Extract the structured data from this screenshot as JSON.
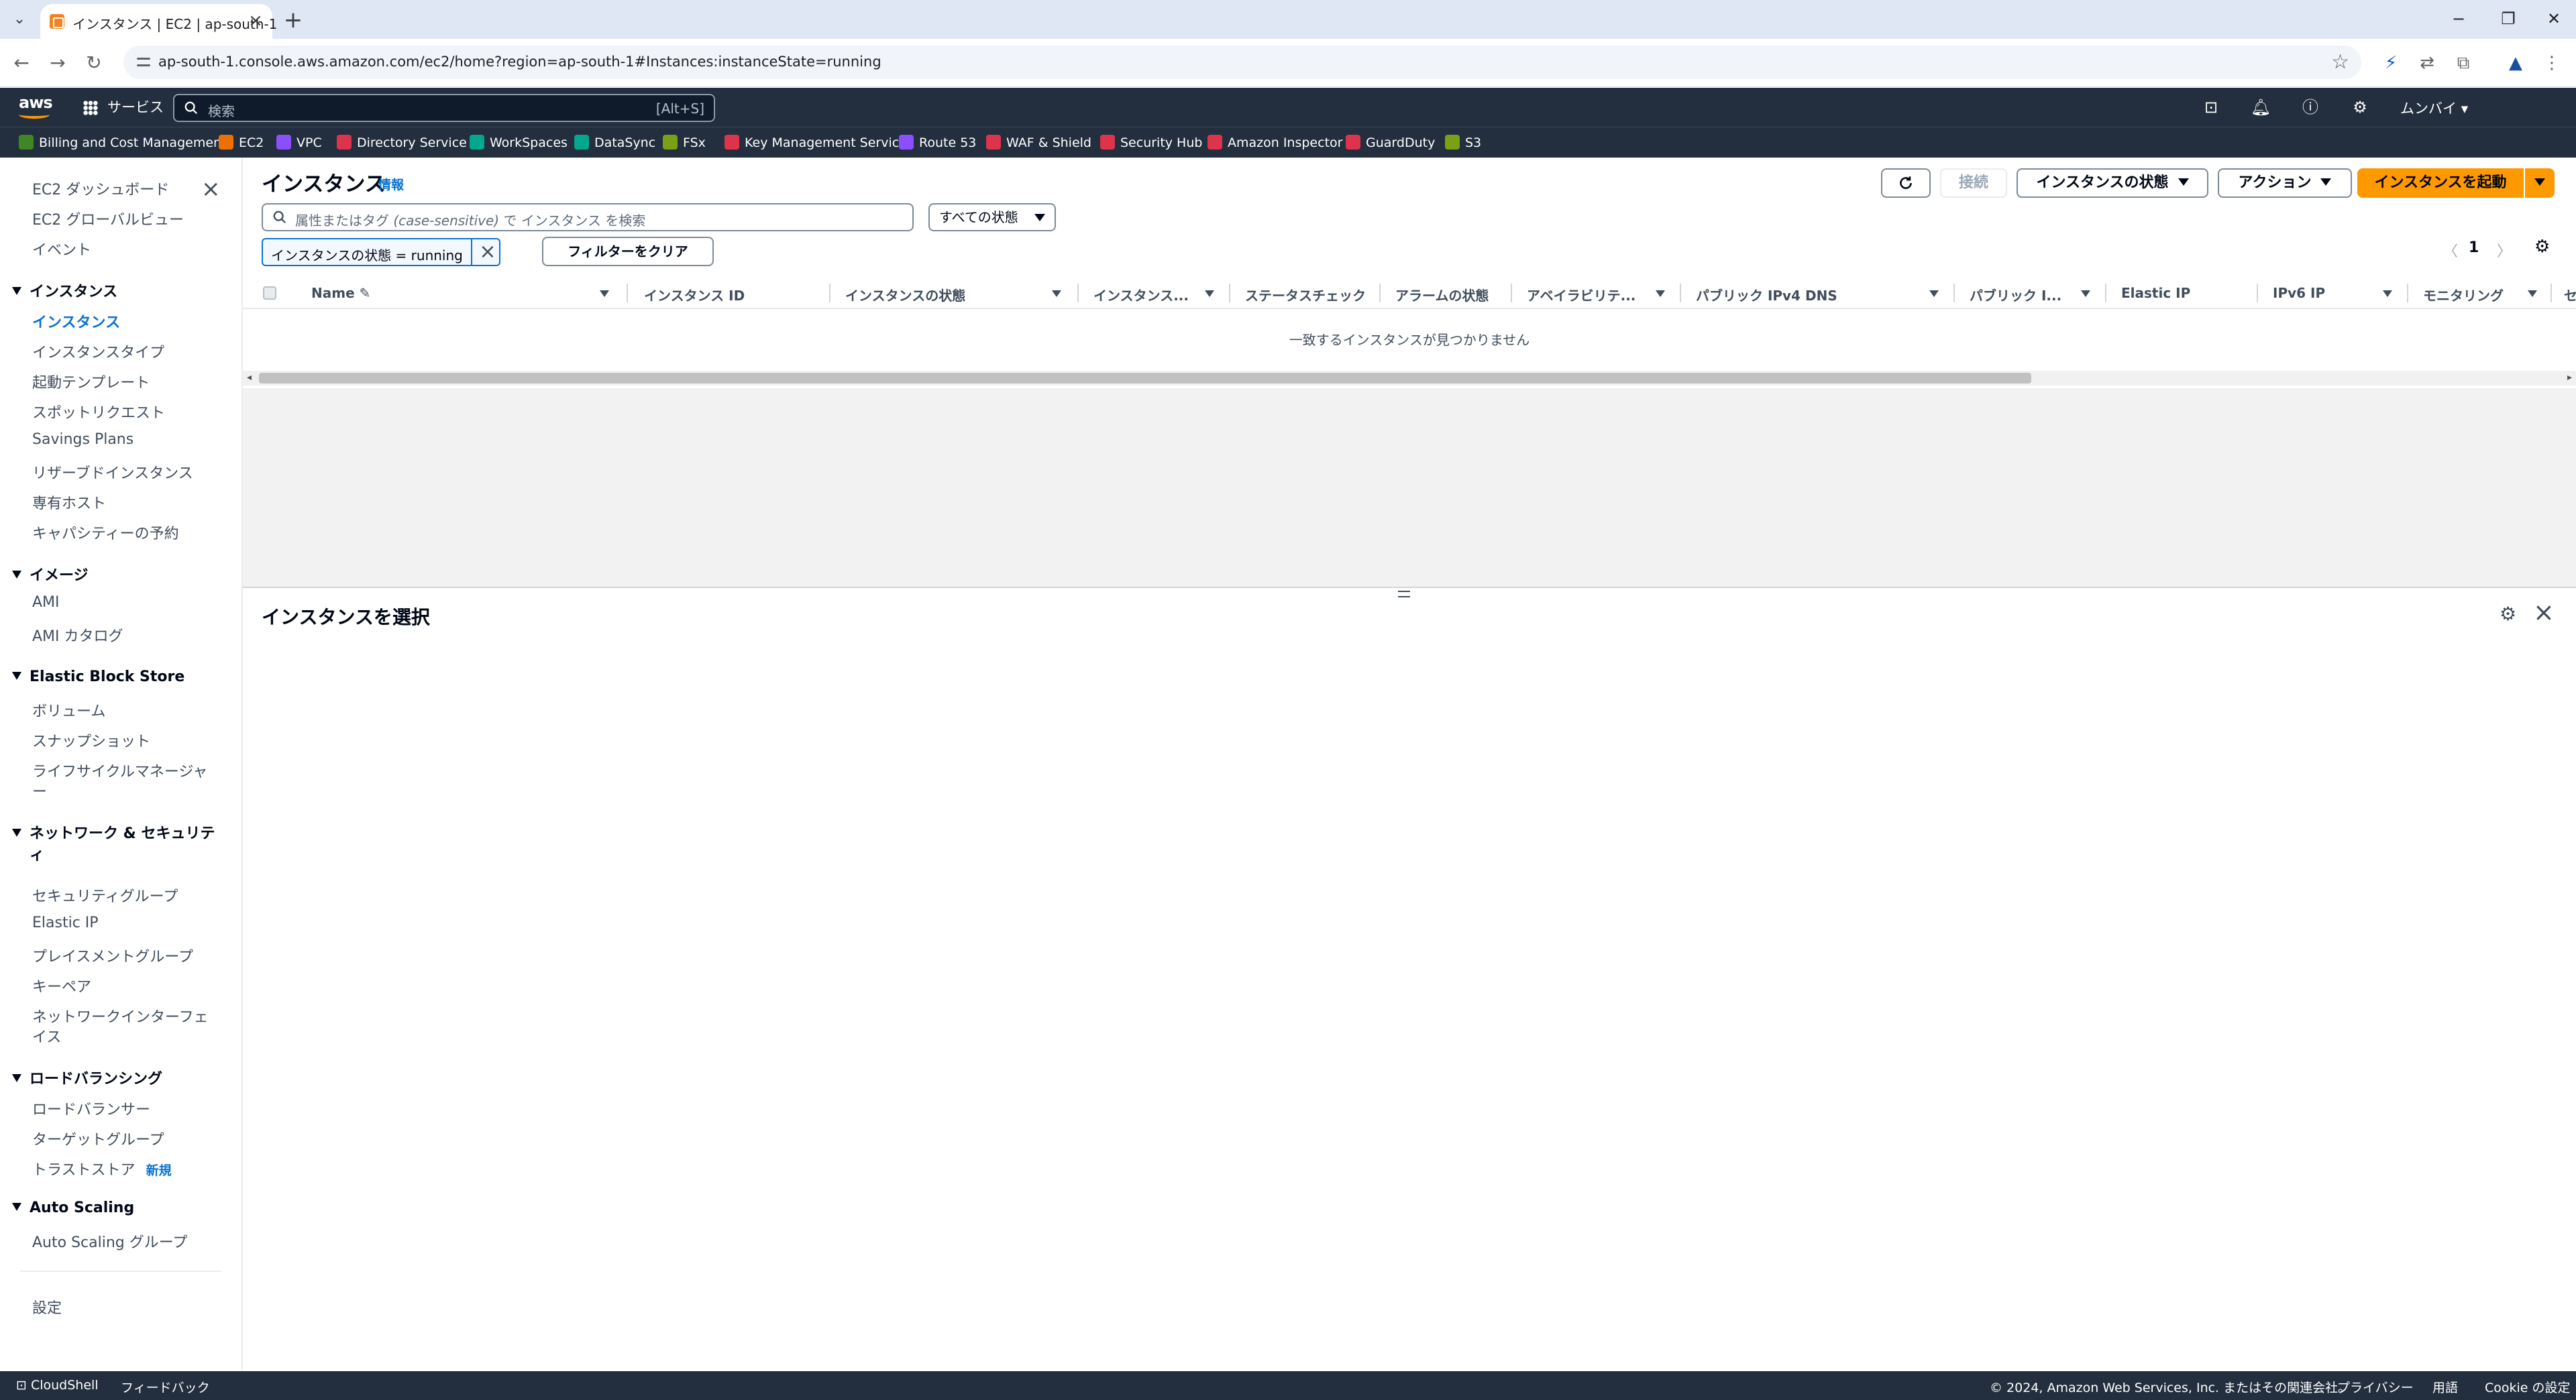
{
  "browser": {
    "tab_title": "インスタンス | EC2 | ap-south-1",
    "url": "ap-south-1.console.aws.amazon.com/ec2/home?region=ap-south-1#Instances:instanceState=running"
  },
  "aws_header": {
    "services_label": "サービス",
    "search_placeholder": "検索",
    "search_shortcut": "[Alt+S]",
    "region": "ムンバイ ▾"
  },
  "favorites": [
    {
      "label": "Billing and Cost Management",
      "color": "#3f8624"
    },
    {
      "label": "EC2",
      "color": "#ed7100"
    },
    {
      "label": "VPC",
      "color": "#8c4fff"
    },
    {
      "label": "Directory Service",
      "color": "#dd344c"
    },
    {
      "label": "WorkSpaces",
      "color": "#01a88d"
    },
    {
      "label": "DataSync",
      "color": "#01a88d"
    },
    {
      "label": "FSx",
      "color": "#7aa116"
    },
    {
      "label": "Key Management Service",
      "color": "#dd344c"
    },
    {
      "label": "Route 53",
      "color": "#8c4fff"
    },
    {
      "label": "WAF & Shield",
      "color": "#dd344c"
    },
    {
      "label": "Security Hub",
      "color": "#dd344c"
    },
    {
      "label": "Amazon Inspector",
      "color": "#dd344c"
    },
    {
      "label": "GuardDuty",
      "color": "#dd344c"
    },
    {
      "label": "S3",
      "color": "#7aa116"
    }
  ],
  "sidebar": {
    "top_items": [
      "EC2 ダッシュボード",
      "EC2 グローバルビュー",
      "イベント"
    ],
    "sections": [
      {
        "title": "インスタンス",
        "items": [
          "インスタンス",
          "インスタンスタイプ",
          "起動テンプレート",
          "スポットリクエスト",
          "Savings Plans",
          "リザーブドインスタンス",
          "専有ホスト",
          "キャパシティーの予約"
        ]
      },
      {
        "title": "イメージ",
        "items": [
          "AMI",
          "AMI カタログ"
        ]
      },
      {
        "title": "Elastic Block Store",
        "items": [
          "ボリューム",
          "スナップショット",
          "ライフサイクルマネージャ",
          "ー"
        ]
      },
      {
        "title_line1": "ネットワーク & セキュリテ",
        "title_line2": "ィ",
        "items": [
          "セキュリティグループ",
          "Elastic IP",
          "プレイスメントグループ",
          "キーペア",
          "ネットワークインターフェ",
          "イス"
        ]
      },
      {
        "title": "ロードバランシング",
        "items": [
          "ロードバランサー",
          "ターゲットグループ",
          "トラストストア"
        ],
        "new_badge": "新規"
      },
      {
        "title": "Auto Scaling",
        "items": [
          "Auto Scaling グループ"
        ]
      }
    ],
    "settings": "設定"
  },
  "main": {
    "title": "インスタンス",
    "info": "情報",
    "buttons": {
      "connect": "接続",
      "instance_state": "インスタンスの状態",
      "actions": "アクション",
      "launch": "インスタンスを起動",
      "clear_filters": "フィルターをクリア"
    },
    "search_placeholder_pre": "属性またはタグ",
    "search_placeholder_italic": "(case-sensitive)",
    "search_placeholder_post": "で インスタンス を検索",
    "state_filter": "すべての状態",
    "token": "インスタンスの状態 = running",
    "page": "1",
    "columns": [
      "Name",
      "インスタンス ID",
      "インスタンスの状態",
      "インスタンス...",
      "ステータスチェック",
      "アラームの状態",
      "アベイラビリテ...",
      "パブリック IPv4 DNS",
      "パブリック I...",
      "Elastic IP",
      "IPv6 IP",
      "モニタリング",
      "セ"
    ],
    "empty_message": "一致するインスタンスが見つかりません",
    "detail_title": "インスタンスを選択"
  },
  "footer": {
    "cloudshell": "CloudShell",
    "feedback": "フィードバック",
    "copyright": "© 2024, Amazon Web Services, Inc. またはその関連会社。",
    "privacy": "プライバシー",
    "terms": "用語",
    "cookies": "Cookie の設定"
  }
}
